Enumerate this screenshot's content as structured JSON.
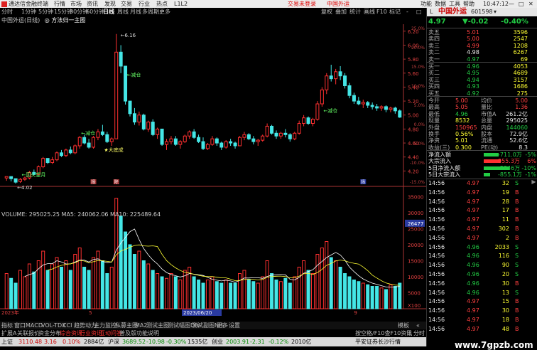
{
  "app": {
    "title": "通达信金融终端",
    "menu": [
      "行情",
      "市场",
      "资讯",
      "发现",
      "交易",
      "行业",
      "热点",
      "L1L2"
    ],
    "menu_right": [
      "交易未登录",
      "中国外运"
    ],
    "sysmenu": [
      "功能",
      "数据",
      "工具",
      "帮助"
    ],
    "clock": "10:47:12"
  },
  "toolbar": {
    "periods": [
      "分时",
      "1分钟",
      "5分钟",
      "15分钟",
      "30分钟",
      "60分钟",
      "日线",
      "周线",
      "月线",
      "多周期",
      "更多"
    ],
    "right": [
      "复权",
      "叠加",
      "统计",
      "画线",
      "F10",
      "标记",
      "-",
      "□"
    ]
  },
  "chart": {
    "stock_title": "中国外运(日线)",
    "indicator": "方法归一主图",
    "annotations": {
      "high": "6.16",
      "low": "4.02",
      "tags": [
        "减仓",
        "减仓",
        "大底成",
        "因火望月",
        "减仓"
      ]
    },
    "markers": [
      "扬",
      "除",
      "扬"
    ],
    "volume_legend": "VOLUME: 295025.25  MA5: 240062.06  MA10: 225489.64",
    "date_label": "2023/06/20",
    "axis_years": [
      "2023年",
      "5",
      "9"
    ],
    "vol_axis": [
      "35000",
      "30000",
      "25000",
      "20000",
      "15000",
      "10000",
      "5000",
      "X100"
    ],
    "vol_box": "26477",
    "price_axis": [
      "6.20",
      "6.00",
      "5.80",
      "5.60",
      "5.40",
      "5.20",
      "5.00",
      "4.80",
      "4.60",
      "4.40",
      "4.20"
    ],
    "pct_axis": [
      "25.0%",
      "20.0%",
      "15.0%",
      "10.0%",
      "5.0%",
      "0.0%",
      "-5.0%",
      "-10.0%",
      "-15.0%"
    ]
  },
  "chart_data": {
    "type": "candlestick",
    "title": "中国外运(日线)",
    "candles": [
      [
        4.1,
        4.12,
        4.06,
        4.12
      ],
      [
        4.12,
        4.11,
        4.05,
        4.09
      ],
      [
        4.09,
        4.08,
        4.02,
        4.04
      ],
      [
        4.05,
        4.1,
        4.03,
        4.08
      ],
      [
        4.08,
        4.12,
        4.06,
        4.1
      ],
      [
        4.1,
        4.2,
        4.08,
        4.18
      ],
      [
        4.18,
        4.22,
        4.14,
        4.15
      ],
      [
        4.15,
        4.28,
        4.14,
        4.26
      ],
      [
        4.26,
        4.4,
        4.24,
        4.38
      ],
      [
        4.38,
        4.36,
        4.3,
        4.32
      ],
      [
        4.32,
        4.4,
        4.3,
        4.36
      ],
      [
        4.36,
        4.48,
        4.34,
        4.46
      ],
      [
        4.46,
        4.5,
        4.4,
        4.42
      ],
      [
        4.42,
        4.52,
        4.4,
        4.5
      ],
      [
        4.5,
        4.55,
        4.44,
        4.46
      ],
      [
        4.46,
        4.58,
        4.44,
        4.56
      ],
      [
        4.56,
        4.7,
        4.52,
        4.68
      ],
      [
        4.68,
        4.72,
        4.58,
        4.6
      ],
      [
        4.6,
        4.66,
        4.52,
        4.54
      ],
      [
        4.54,
        4.7,
        4.52,
        4.68
      ],
      [
        4.68,
        4.8,
        4.64,
        4.76
      ],
      [
        4.76,
        4.86,
        4.7,
        4.72
      ],
      [
        4.72,
        4.76,
        4.6,
        4.62
      ],
      [
        4.62,
        4.68,
        4.56,
        4.66
      ],
      [
        4.66,
        6.16,
        4.66,
        5.9
      ],
      [
        5.9,
        6.0,
        5.6,
        5.7
      ],
      [
        5.7,
        5.6,
        5.15,
        5.2
      ],
      [
        5.2,
        5.2,
        4.98,
        5.02
      ],
      [
        5.02,
        5.1,
        4.86,
        4.9
      ],
      [
        4.9,
        5.05,
        4.85,
        5.0
      ],
      [
        5.0,
        5.02,
        4.78,
        4.8
      ],
      [
        4.8,
        4.92,
        4.76,
        4.9
      ],
      [
        4.9,
        4.94,
        4.7,
        4.72
      ],
      [
        4.72,
        4.82,
        4.66,
        4.8
      ],
      [
        4.8,
        4.8,
        4.56,
        4.58
      ],
      [
        4.58,
        4.66,
        4.5,
        4.62
      ],
      [
        4.62,
        4.7,
        4.58,
        4.66
      ],
      [
        4.66,
        4.7,
        4.56,
        4.58
      ],
      [
        4.58,
        4.64,
        4.52,
        4.62
      ],
      [
        4.62,
        4.72,
        4.6,
        4.7
      ],
      [
        4.7,
        4.78,
        4.66,
        4.76
      ],
      [
        4.76,
        4.8,
        4.66,
        4.68
      ],
      [
        4.68,
        4.72,
        4.6,
        4.62
      ],
      [
        4.62,
        4.68,
        4.5,
        4.52
      ],
      [
        4.52,
        4.6,
        4.5,
        4.58
      ],
      [
        4.58,
        4.7,
        4.56,
        4.66
      ],
      [
        4.66,
        4.68,
        4.56,
        4.6
      ],
      [
        4.6,
        4.62,
        4.5,
        4.54
      ],
      [
        4.54,
        4.64,
        4.52,
        4.62
      ],
      [
        4.62,
        4.66,
        4.56,
        4.6
      ],
      [
        4.6,
        4.62,
        4.52,
        4.56
      ],
      [
        4.56,
        4.7,
        4.56,
        4.68
      ],
      [
        4.68,
        4.76,
        4.64,
        4.72
      ],
      [
        4.72,
        4.74,
        4.64,
        4.66
      ],
      [
        4.66,
        4.7,
        4.58,
        4.62
      ],
      [
        4.62,
        4.66,
        4.56,
        4.64
      ],
      [
        4.64,
        4.72,
        4.62,
        4.7
      ],
      [
        4.7,
        4.88,
        4.68,
        4.84
      ],
      [
        4.84,
        4.86,
        4.72,
        4.74
      ],
      [
        4.74,
        4.78,
        4.66,
        4.7
      ],
      [
        4.7,
        4.76,
        4.66,
        4.74
      ],
      [
        4.74,
        4.8,
        4.68,
        4.72
      ],
      [
        4.72,
        4.74,
        4.62,
        4.66
      ],
      [
        4.66,
        4.76,
        4.64,
        4.74
      ],
      [
        4.74,
        4.92,
        4.72,
        4.88
      ],
      [
        4.88,
        5.0,
        4.84,
        4.96
      ],
      [
        4.96,
        4.98,
        4.86,
        4.88
      ],
      [
        4.88,
        4.96,
        4.84,
        4.94
      ],
      [
        4.94,
        5.2,
        4.92,
        5.16
      ],
      [
        5.16,
        5.4,
        5.12,
        5.36
      ],
      [
        5.36,
        5.6,
        5.3,
        5.56
      ],
      [
        5.56,
        5.72,
        5.48,
        5.52
      ],
      [
        5.52,
        5.66,
        5.44,
        5.62
      ],
      [
        5.62,
        5.7,
        5.5,
        5.56
      ],
      [
        5.56,
        5.6,
        5.38,
        5.42
      ],
      [
        5.42,
        5.46,
        5.24,
        5.28
      ],
      [
        5.28,
        5.32,
        5.16,
        5.2
      ],
      [
        5.2,
        5.26,
        5.14,
        5.16
      ],
      [
        5.16,
        5.22,
        5.1,
        5.18
      ],
      [
        5.18,
        5.2,
        5.1,
        5.14
      ],
      [
        5.14,
        5.18,
        5.08,
        5.12
      ],
      [
        5.12,
        5.16,
        5.06,
        5.1
      ],
      [
        5.1,
        5.14,
        5.06,
        5.12
      ],
      [
        5.12,
        5.14,
        5.04,
        5.08
      ],
      [
        5.08,
        5.12,
        5.04,
        5.1
      ],
      [
        5.1,
        5.12,
        5.02,
        5.06
      ],
      [
        5.06,
        5.08,
        4.96,
        4.97
      ]
    ],
    "volume": [
      110,
      95,
      80,
      120,
      100,
      140,
      115,
      150,
      180,
      120,
      140,
      160,
      130,
      150,
      120,
      170,
      190,
      130,
      120,
      160,
      180,
      150,
      110,
      130,
      345,
      290,
      240,
      200,
      170,
      180,
      150,
      140,
      120,
      110,
      100,
      95,
      110,
      100,
      90,
      120,
      130,
      100,
      90,
      80,
      90,
      100,
      85,
      80,
      90,
      80,
      80,
      110,
      120,
      90,
      85,
      80,
      100,
      150,
      110,
      90,
      85,
      95,
      80,
      100,
      130,
      150,
      120,
      110,
      170,
      190,
      210,
      160,
      150,
      130,
      110,
      100,
      90,
      85,
      80,
      75,
      70,
      70,
      65,
      60,
      75,
      70,
      80
    ],
    "ylim": [
      4.0,
      6.3
    ],
    "vol_ylim": [
      0,
      360
    ]
  },
  "panel": {
    "symbol_name": "中国外运",
    "symbol_code": "601598",
    "price": "4.97",
    "change": "▼-0.02",
    "change_pct": "-0.40%",
    "asks": [
      {
        "label": "卖五",
        "price": "5.01",
        "vol": "3596"
      },
      {
        "label": "卖四",
        "price": "5.00",
        "vol": "2547"
      },
      {
        "label": "卖三",
        "price": "4.99",
        "vol": "1208"
      },
      {
        "label": "卖二",
        "price": "4.98",
        "vol": "6267"
      },
      {
        "label": "卖一",
        "price": "4.97",
        "vol": "69"
      }
    ],
    "bids": [
      {
        "label": "买一",
        "price": "4.96",
        "vol": "4053"
      },
      {
        "label": "买二",
        "price": "4.95",
        "vol": "4689"
      },
      {
        "label": "买三",
        "price": "4.94",
        "vol": "3157"
      },
      {
        "label": "买四",
        "price": "4.93",
        "vol": "1686"
      },
      {
        "label": "买五",
        "price": "4.92",
        "vol": "275"
      }
    ],
    "stats": [
      {
        "l1": "今开",
        "v1": "5.00",
        "l2": "均价",
        "v2": "5.00"
      },
      {
        "l1": "最高",
        "v1": "5.05",
        "l2": "量比",
        "v2": "1.36"
      },
      {
        "l1": "最低",
        "v1": "4.96",
        "l2": "市值A",
        "v2": "261.2亿"
      },
      {
        "l1": "现量",
        "v1": "8532",
        "l2": "总量",
        "v2": "295025"
      },
      {
        "l1": "外盘",
        "v1": "150965",
        "l2": "内盘",
        "v2": "144060"
      },
      {
        "l1": "换手",
        "v1": "0.56%",
        "l2": "股本",
        "v2": "72.9亿"
      },
      {
        "l1": "净资",
        "v1": "5.01",
        "l2": "流通",
        "v2": "52.6亿"
      },
      {
        "l1": "收益(三)",
        "v1": "0.300",
        "l2": "PE(动)",
        "v2": "8.3"
      }
    ],
    "flows": [
      {
        "label": "净流入额",
        "value": "-711.0万",
        "pct": "-5%"
      },
      {
        "label": "大宗流入",
        "value": "955.3万",
        "pct": "6%"
      },
      {
        "label": "5日净流入额",
        "value": "-5946万",
        "pct": "-10%"
      },
      {
        "label": "5日大宗流入",
        "value": "-855.1万",
        "pct": "-1%"
      }
    ],
    "ticks": [
      {
        "t": "14:56",
        "p": "4.97",
        "v": "32",
        "s": "S"
      },
      {
        "t": "14:56",
        "p": "4.97",
        "v": "19",
        "s": "B"
      },
      {
        "t": "14:56",
        "p": "4.97",
        "v": "28",
        "s": "B"
      },
      {
        "t": "14:56",
        "p": "4.97",
        "v": "17",
        "s": "B"
      },
      {
        "t": "14:56",
        "p": "4.97",
        "v": "11",
        "s": "B"
      },
      {
        "t": "14:56",
        "p": "4.97",
        "v": "302",
        "s": "B"
      },
      {
        "t": "14:56",
        "p": "4.97",
        "v": "2",
        "s": "B"
      },
      {
        "t": "14:56",
        "p": "4.96",
        "v": "2033",
        "s": "S"
      },
      {
        "t": "14:56",
        "p": "4.96",
        "v": "116",
        "s": "S"
      },
      {
        "t": "14:56",
        "p": "4.96",
        "v": "90",
        "s": "S"
      },
      {
        "t": "14:56",
        "p": "4.96",
        "v": "20",
        "s": "S"
      },
      {
        "t": "14:56",
        "p": "4.96",
        "v": "30",
        "s": "B"
      },
      {
        "t": "14:56",
        "p": "4.96",
        "v": "13",
        "s": "S"
      },
      {
        "t": "14:56",
        "p": "4.97",
        "v": "15",
        "s": "B"
      },
      {
        "t": "14:56",
        "p": "4.97",
        "v": "30",
        "s": "B"
      },
      {
        "t": "14:56",
        "p": "4.97",
        "v": "18",
        "s": "B"
      },
      {
        "t": "14:56",
        "p": "4.97",
        "v": "48",
        "s": "B"
      }
    ]
  },
  "bottom": {
    "tabs": [
      "指标",
      "窗口",
      "MACD",
      "VOL-TDX",
      "CCI",
      "趋势动力",
      "主力监控",
      "私募主图",
      "MA2",
      "测试主图",
      "测试幅图DIV",
      "测试副图NIS",
      "更多",
      "设置"
    ],
    "tabs_right": [
      "模板",
      "«"
    ],
    "tabs2": [
      "扩展A",
      "关联报价",
      "资金分布",
      "综合资讯",
      "行业资讯",
      "互动问答",
      "普及版功能说明"
    ],
    "tabs2_right": [
      "按空格/F10查F10资讯",
      "日",
      "分时"
    ]
  },
  "status": {
    "items": [
      {
        "name": "上证",
        "value": "3110.48",
        "chg": "3.16",
        "pct": "0.10%",
        "amt": "2884亿"
      },
      {
        "name": "沪深",
        "value": "3689.52",
        "chg": "-10.98",
        "pct": "-0.30%",
        "amt": "1535亿"
      },
      {
        "name": "创业",
        "value": "2003.91",
        "chg": "-2.31",
        "pct": "-0.12%",
        "amt": "2010亿"
      }
    ],
    "broker": "平安证券长沙行情"
  },
  "watermark": "www.7gpzb.com"
}
